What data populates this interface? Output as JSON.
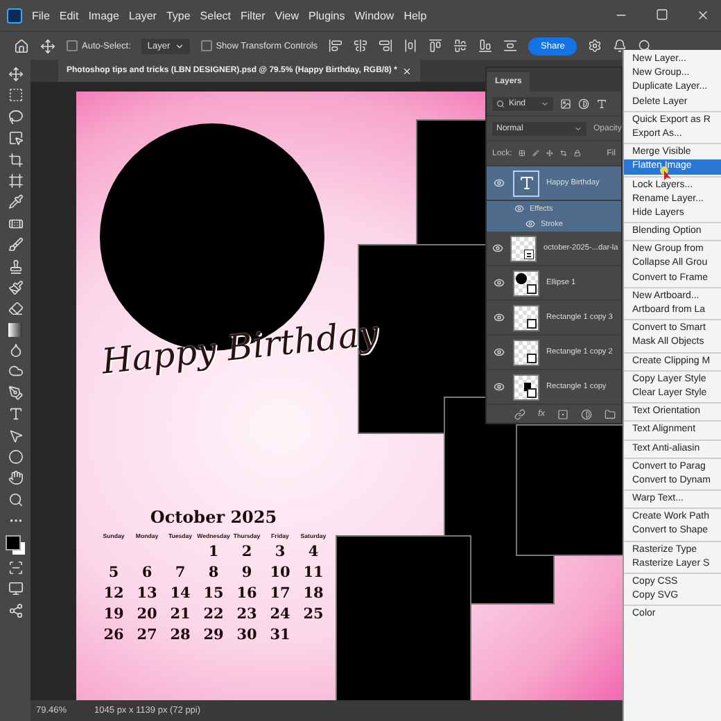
{
  "menu_bar": {
    "items": [
      "File",
      "Edit",
      "Image",
      "Layer",
      "Type",
      "Select",
      "Filter",
      "View",
      "Plugins",
      "Window",
      "Help"
    ]
  },
  "options_bar": {
    "auto_select": {
      "label": "Auto-Select:",
      "checked": false
    },
    "target": "Layer",
    "show_transform": {
      "label": "Show Transform Controls",
      "checked": false
    },
    "share": "Share"
  },
  "document_tab": {
    "title": "Photoshop tips and tricks (LBN DESIGNER).psd @ 79.5% (Happy Birthday, RGB/8) *"
  },
  "canvas": {
    "heading": "Happy Birthday",
    "calendar": {
      "title": "October 2025",
      "weekdays": [
        "Sunday",
        "Monday",
        "Tuesday",
        "Wednesday",
        "Thursday",
        "Friday",
        "Saturday"
      ],
      "weeks": [
        [
          "1",
          "2",
          "3",
          "4"
        ],
        [
          "5",
          "6",
          "7",
          "8",
          "9",
          "10",
          "11"
        ],
        [
          "12",
          "13",
          "14",
          "15",
          "16",
          "17",
          "18"
        ],
        [
          "19",
          "20",
          "21",
          "22",
          "23",
          "24",
          "25"
        ],
        [
          "26",
          "27",
          "28",
          "29",
          "30",
          "31"
        ]
      ]
    }
  },
  "layers_panel": {
    "tab": "Layers",
    "filter": "Kind",
    "blend_mode": "Normal",
    "opacity_label": "Opacity",
    "lock_label": "Lock:",
    "fill_label": "Fil",
    "fx": "fx",
    "layers": [
      {
        "name": "Happy Birthday",
        "kind": "text",
        "selected": true,
        "visible": true,
        "effects": {
          "label": "Effects",
          "items": [
            "Stroke"
          ]
        }
      },
      {
        "name": "october-2025-...dar-la",
        "kind": "image",
        "selected": false,
        "visible": true
      },
      {
        "name": "Ellipse 1",
        "kind": "ellipse",
        "selected": false,
        "visible": true
      },
      {
        "name": "Rectangle 1 copy 3",
        "kind": "rectangle",
        "selected": false,
        "visible": true
      },
      {
        "name": "Rectangle 1 copy 2",
        "kind": "rectangle",
        "selected": false,
        "visible": true
      },
      {
        "name": "Rectangle 1 copy",
        "kind": "rectangle-filled",
        "selected": false,
        "visible": true
      }
    ]
  },
  "context_menu": {
    "groups": [
      [
        {
          "label": "New Layer...",
          "selected": false
        },
        {
          "label": "New Group...",
          "selected": false
        },
        {
          "label": "Duplicate Layer...",
          "selected": false
        },
        {
          "label": "Delete Layer",
          "selected": false
        }
      ],
      [
        {
          "label": "Quick Export as R",
          "selected": false
        },
        {
          "label": "Export As...",
          "selected": false
        }
      ],
      [
        {
          "label": "Merge Visible",
          "selected": false
        },
        {
          "label": "Flatten Image",
          "selected": true
        }
      ],
      [
        {
          "label": "Lock Layers...",
          "selected": false
        },
        {
          "label": "Rename Layer...",
          "selected": false
        },
        {
          "label": "Hide Layers",
          "selected": false
        }
      ],
      [
        {
          "label": "Blending Option",
          "selected": false
        }
      ],
      [
        {
          "label": "New Group from",
          "selected": false
        },
        {
          "label": "Collapse All Grou",
          "selected": false
        },
        {
          "label": "Convert to Frame",
          "selected": false
        }
      ],
      [
        {
          "label": "New Artboard...",
          "selected": false
        },
        {
          "label": "Artboard from La",
          "selected": false
        }
      ],
      [
        {
          "label": "Convert to Smart",
          "selected": false
        },
        {
          "label": "Mask All Objects",
          "selected": false
        }
      ],
      [
        {
          "label": "Create Clipping M",
          "selected": false
        }
      ],
      [
        {
          "label": "Copy Layer Style",
          "selected": false
        },
        {
          "label": "Clear Layer Style",
          "selected": false
        }
      ],
      [
        {
          "label": "Text Orientation",
          "selected": false
        }
      ],
      [
        {
          "label": "Text Alignment",
          "selected": false
        }
      ],
      [
        {
          "label": "Text Anti-aliasin",
          "selected": false
        }
      ],
      [
        {
          "label": "Convert to Parag",
          "selected": false
        },
        {
          "label": "Convert to Dynam",
          "selected": false
        }
      ],
      [
        {
          "label": "Warp Text...",
          "selected": false
        }
      ],
      [
        {
          "label": "Create Work Path",
          "selected": false
        },
        {
          "label": "Convert to Shape",
          "selected": false
        }
      ],
      [
        {
          "label": "Rasterize Type",
          "selected": false
        },
        {
          "label": "Rasterize Layer S",
          "selected": false
        }
      ],
      [
        {
          "label": "Copy CSS",
          "selected": false
        },
        {
          "label": "Copy SVG",
          "selected": false
        }
      ],
      [
        {
          "label": "Color",
          "selected": false
        }
      ]
    ]
  },
  "status_bar": {
    "zoom": "79.46%",
    "size": "1045 px x 1139 px (72 ppi)"
  }
}
